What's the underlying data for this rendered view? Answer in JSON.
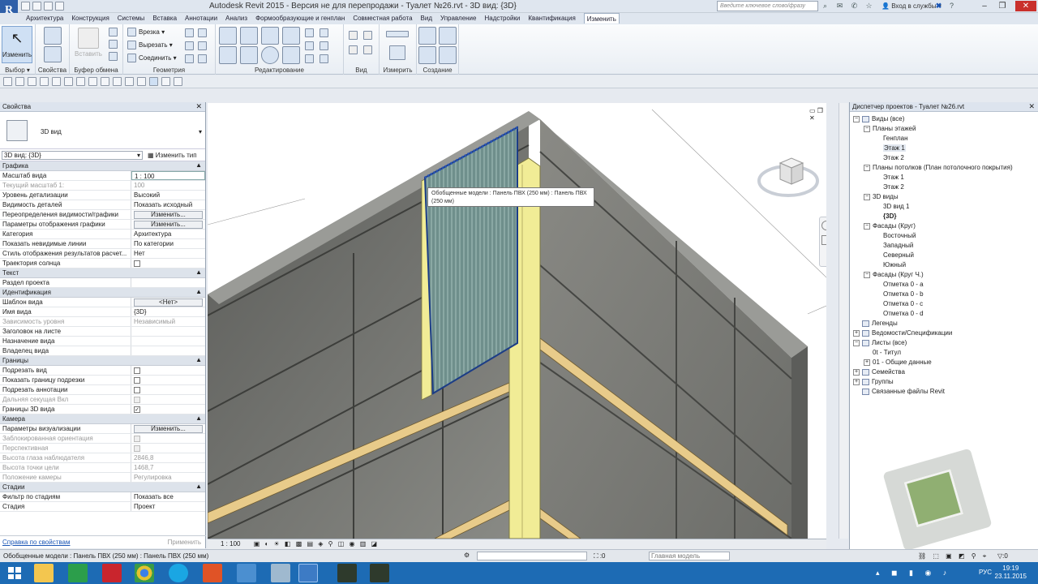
{
  "app": {
    "title": "Autodesk Revit 2015 - Версия не для перепродажи -     Туалет №26.rvt - 3D вид: {3D}",
    "logo": "R",
    "search_placeholder": "Введите ключевое слово/фразу",
    "login": "Вход в службы",
    "tabs": [
      "Архитектура",
      "Конструкция",
      "Системы",
      "Вставка",
      "Аннотации",
      "Анализ",
      "Формообразующие и генплан",
      "Совместная работа",
      "Вид",
      "Управление",
      "Надстройки",
      "Квантификация",
      "Изменить"
    ]
  },
  "ribbon": {
    "select_label": "Изменить",
    "select_panel": "Выбор ▾",
    "props_panel": "Свойства",
    "clipboard_insert": "Вставить",
    "clipboard_panel": "Буфер обмена",
    "geometry_items": [
      "Врезка ▾",
      "Вырезать ▾",
      "Соединить ▾"
    ],
    "geometry_panel": "Геометрия",
    "edit_panel": "Редактирование",
    "view_panel": "Вид",
    "measure_panel": "Измерить",
    "create_panel": "Создание"
  },
  "properties": {
    "title": "Свойства",
    "type_name": "3D вид",
    "instance_filter": "3D вид: {3D}",
    "edit_type": "Изменить тип",
    "groups": [
      {
        "name": "Графика",
        "rows": [
          {
            "k": "Масштаб вида",
            "v": "1 : 100",
            "box": true
          },
          {
            "k": "Текущий масштаб  1:",
            "v": "100",
            "dis": true
          },
          {
            "k": "Уровень детализации",
            "v": "Высокий"
          },
          {
            "k": "Видимость деталей",
            "v": "Показать исходный"
          },
          {
            "k": "Переопределения видимости/графики",
            "v": "Изменить...",
            "btn": true
          },
          {
            "k": "Параметры отображения графики",
            "v": "Изменить...",
            "btn": true
          },
          {
            "k": "Категория",
            "v": "Архитектура"
          },
          {
            "k": "Показать невидимые линии",
            "v": "По категории"
          },
          {
            "k": "Стиль отображения результатов расчет...",
            "v": "Нет"
          },
          {
            "k": "Траектория солнца",
            "v": "",
            "chk": "off"
          }
        ]
      },
      {
        "name": "Текст",
        "rows": [
          {
            "k": "Раздел проекта",
            "v": ""
          }
        ]
      },
      {
        "name": "Идентификация",
        "rows": [
          {
            "k": "Шаблон вида",
            "v": "<Нет>",
            "btn": true
          },
          {
            "k": "Имя вида",
            "v": "{3D}"
          },
          {
            "k": "Зависимость уровня",
            "v": "Независимый",
            "dis": true
          },
          {
            "k": "Заголовок на листе",
            "v": ""
          },
          {
            "k": "Назначение вида",
            "v": ""
          },
          {
            "k": "Владелец вида",
            "v": ""
          }
        ]
      },
      {
        "name": "Границы",
        "rows": [
          {
            "k": "Подрезать вид",
            "v": "",
            "chk": "off"
          },
          {
            "k": "Показать границу подрезки",
            "v": "",
            "chk": "off"
          },
          {
            "k": "Подрезать аннотации",
            "v": "",
            "chk": "off"
          },
          {
            "k": "Дальняя секущая Вкл",
            "v": "",
            "chk": "off",
            "dis": true
          },
          {
            "k": "Границы 3D вида",
            "v": "",
            "chk": "on"
          }
        ]
      },
      {
        "name": "Камера",
        "rows": [
          {
            "k": "Параметры визуализации",
            "v": "Изменить...",
            "btn": true
          },
          {
            "k": "Заблокированная ориентация",
            "v": "",
            "chk": "off",
            "dis": true
          },
          {
            "k": "Перспективная",
            "v": "",
            "chk": "off",
            "dis": true
          },
          {
            "k": "Высота глаза наблюдателя",
            "v": "2846,8",
            "dis": true
          },
          {
            "k": "Высота точки цели",
            "v": "1468,7",
            "dis": true
          },
          {
            "k": "Положение камеры",
            "v": "Регулировка",
            "dis": true
          }
        ]
      },
      {
        "name": "Стадии",
        "rows": [
          {
            "k": "Фильтр по стадиям",
            "v": "Показать все"
          },
          {
            "k": "Стадия",
            "v": "Проект"
          }
        ]
      }
    ],
    "help_link": "Справка по свойствам",
    "apply": "Применить"
  },
  "viewport": {
    "tooltip": "Обобщенные модели : Панель ПВХ (250 мм) : Панель ПВХ (250 мм)",
    "scale": "1 : 100",
    "colors": {
      "concrete": "#6f706c",
      "panel": "#6f8f8c",
      "stud": "#f1ec96",
      "beam": "#e8cb8a"
    }
  },
  "browser": {
    "title": "Диспетчер проектов - Туалет №26.rvt",
    "nodes": [
      {
        "lvl": 0,
        "tg": "−",
        "t": "Виды (все)",
        "ic": true
      },
      {
        "lvl": 1,
        "tg": "−",
        "t": "Планы этажей"
      },
      {
        "lvl": 2,
        "t": "Генплан"
      },
      {
        "lvl": 2,
        "t": "Этаж 1",
        "sel": true
      },
      {
        "lvl": 2,
        "t": "Этаж 2"
      },
      {
        "lvl": 1,
        "tg": "−",
        "t": "Планы потолков (План потолочного покрытия)"
      },
      {
        "lvl": 2,
        "t": "Этаж 1"
      },
      {
        "lvl": 2,
        "t": "Этаж 2"
      },
      {
        "lvl": 1,
        "tg": "−",
        "t": "3D виды"
      },
      {
        "lvl": 2,
        "t": "3D вид 1"
      },
      {
        "lvl": 2,
        "t": "{3D}",
        "bold": true
      },
      {
        "lvl": 1,
        "tg": "−",
        "t": "Фасады (Круг)"
      },
      {
        "lvl": 2,
        "t": "Восточный"
      },
      {
        "lvl": 2,
        "t": "Западный"
      },
      {
        "lvl": 2,
        "t": "Северный"
      },
      {
        "lvl": 2,
        "t": "Южный"
      },
      {
        "lvl": 1,
        "tg": "−",
        "t": "Фасады (Круг Ч.)"
      },
      {
        "lvl": 2,
        "t": "Отметка 0 - a"
      },
      {
        "lvl": 2,
        "t": "Отметка 0 - b"
      },
      {
        "lvl": 2,
        "t": "Отметка 0 - c"
      },
      {
        "lvl": 2,
        "t": "Отметка 0 - d"
      },
      {
        "lvl": 0,
        "t": "Легенды",
        "ic": true
      },
      {
        "lvl": 0,
        "tg": "+",
        "t": "Ведомости/Спецификации",
        "ic": true
      },
      {
        "lvl": 0,
        "tg": "−",
        "t": "Листы (все)",
        "ic": true
      },
      {
        "lvl": 1,
        "t": "0t - Титул"
      },
      {
        "lvl": 1,
        "tg": "+",
        "t": "01 - Общие данные"
      },
      {
        "lvl": 0,
        "tg": "+",
        "t": "Семейства",
        "ic": true
      },
      {
        "lvl": 0,
        "tg": "+",
        "t": "Группы",
        "ic": true
      },
      {
        "lvl": 0,
        "t": "Связанные файлы Revit",
        "ic": true
      }
    ]
  },
  "status": {
    "text": "Обобщенные модели : Панель ПВХ (250 мм) : Панель ПВХ (250 мм)",
    "sel_count": ":0",
    "model": "Главная модель",
    "filter_count": ":0"
  },
  "taskbar": {
    "time": "19:19",
    "date": "23.11.2015",
    "lang": "РУС"
  }
}
